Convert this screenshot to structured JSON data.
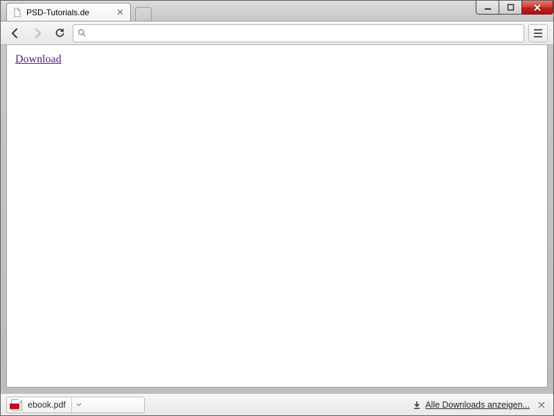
{
  "tab": {
    "title": "PSD-Tutorials.de"
  },
  "toolbar": {
    "url": ""
  },
  "page": {
    "download_link_text": "Download"
  },
  "downloads": {
    "item_filename": "ebook.pdf",
    "show_all_label": "Alle Downloads anzeigen..."
  }
}
